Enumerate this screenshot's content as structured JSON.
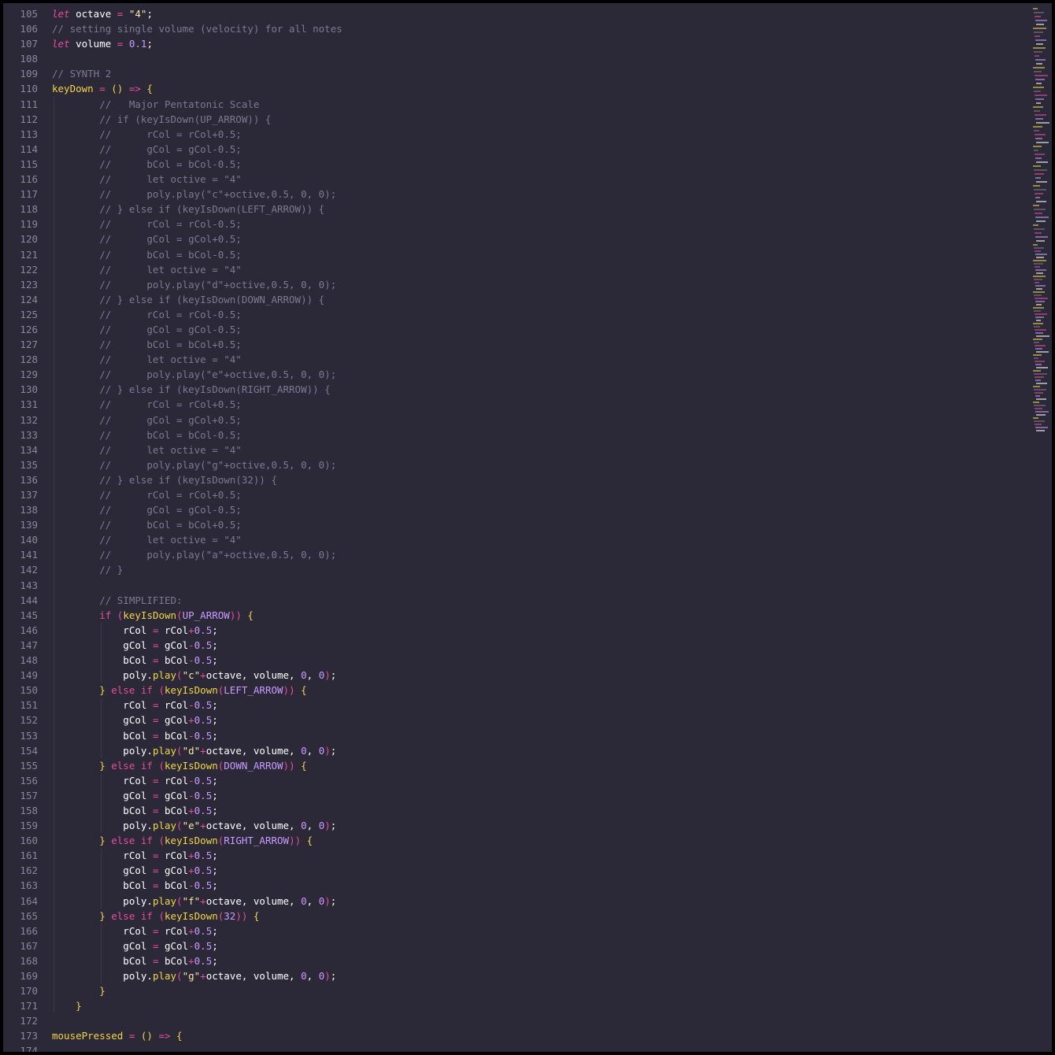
{
  "editor": {
    "first_line": 105,
    "lines": [
      [
        [
          "kw",
          "let"
        ],
        [
          "id",
          " octave "
        ],
        [
          "op",
          "="
        ],
        [
          "str",
          " \"4\""
        ],
        [
          "id",
          ";"
        ]
      ],
      [
        [
          "cmt",
          "// setting single volume (velocity) for all notes"
        ]
      ],
      [
        [
          "kw",
          "let"
        ],
        [
          "id",
          " volume "
        ],
        [
          "op",
          "="
        ],
        [
          "num",
          " 0.1"
        ],
        [
          "id",
          ";"
        ]
      ],
      [],
      [
        [
          "cmt",
          "// SYNTH 2"
        ]
      ],
      [
        [
          "fn",
          "keyDown"
        ],
        [
          "op",
          " ="
        ],
        [
          "brace",
          " ()"
        ],
        [
          "op",
          " =>"
        ],
        [
          "brace",
          " {"
        ]
      ],
      [
        [
          "cmt",
          "        //   Major Pentatonic Scale"
        ]
      ],
      [
        [
          "cmt",
          "        // if (keyIsDown(UP_ARROW)) {"
        ]
      ],
      [
        [
          "cmt",
          "        //      rCol = rCol+0.5;"
        ]
      ],
      [
        [
          "cmt",
          "        //      gCol = gCol-0.5;"
        ]
      ],
      [
        [
          "cmt",
          "        //      bCol = bCol-0.5;"
        ]
      ],
      [
        [
          "cmt",
          "        //      let octive = \"4\""
        ]
      ],
      [
        [
          "cmt",
          "        //      poly.play(\"c\"+octive,0.5, 0, 0);"
        ]
      ],
      [
        [
          "cmt",
          "        // } else if (keyIsDown(LEFT_ARROW)) {"
        ]
      ],
      [
        [
          "cmt",
          "        //      rCol = rCol-0.5;"
        ]
      ],
      [
        [
          "cmt",
          "        //      gCol = gCol+0.5;"
        ]
      ],
      [
        [
          "cmt",
          "        //      bCol = bCol-0.5;"
        ]
      ],
      [
        [
          "cmt",
          "        //      let octive = \"4\""
        ]
      ],
      [
        [
          "cmt",
          "        //      poly.play(\"d\"+octive,0.5, 0, 0);"
        ]
      ],
      [
        [
          "cmt",
          "        // } else if (keyIsDown(DOWN_ARROW)) {"
        ]
      ],
      [
        [
          "cmt",
          "        //      rCol = rCol-0.5;"
        ]
      ],
      [
        [
          "cmt",
          "        //      gCol = gCol-0.5;"
        ]
      ],
      [
        [
          "cmt",
          "        //      bCol = bCol+0.5;"
        ]
      ],
      [
        [
          "cmt",
          "        //      let octive = \"4\""
        ]
      ],
      [
        [
          "cmt",
          "        //      poly.play(\"e\"+octive,0.5, 0, 0);"
        ]
      ],
      [
        [
          "cmt",
          "        // } else if (keyIsDown(RIGHT_ARROW)) {"
        ]
      ],
      [
        [
          "cmt",
          "        //      rCol = rCol+0.5;"
        ]
      ],
      [
        [
          "cmt",
          "        //      gCol = gCol+0.5;"
        ]
      ],
      [
        [
          "cmt",
          "        //      bCol = bCol-0.5;"
        ]
      ],
      [
        [
          "cmt",
          "        //      let octive = \"4\""
        ]
      ],
      [
        [
          "cmt",
          "        //      poly.play(\"g\"+octive,0.5, 0, 0);"
        ]
      ],
      [
        [
          "cmt",
          "        // } else if (keyIsDown(32)) {"
        ]
      ],
      [
        [
          "cmt",
          "        //      rCol = rCol+0.5;"
        ]
      ],
      [
        [
          "cmt",
          "        //      gCol = gCol-0.5;"
        ]
      ],
      [
        [
          "cmt",
          "        //      bCol = bCol+0.5;"
        ]
      ],
      [
        [
          "cmt",
          "        //      let octive = \"4\""
        ]
      ],
      [
        [
          "cmt",
          "        //      poly.play(\"a\"+octive,0.5, 0, 0);"
        ]
      ],
      [
        [
          "cmt",
          "        // }"
        ]
      ],
      [],
      [
        [
          "cmt",
          "        // SIMPLIFIED:"
        ]
      ],
      [
        [
          "id",
          "        "
        ],
        [
          "kw2",
          "if"
        ],
        [
          "paren",
          " ("
        ],
        [
          "fn",
          "keyIsDown"
        ],
        [
          "paren",
          "("
        ],
        [
          "const",
          "UP_ARROW"
        ],
        [
          "paren",
          "))"
        ],
        [
          "brace",
          " {"
        ]
      ],
      [
        [
          "id",
          "            rCol "
        ],
        [
          "op",
          "="
        ],
        [
          "id",
          " rCol"
        ],
        [
          "op",
          "+"
        ],
        [
          "num",
          "0.5"
        ],
        [
          "id",
          ";"
        ]
      ],
      [
        [
          "id",
          "            gCol "
        ],
        [
          "op",
          "="
        ],
        [
          "id",
          " gCol"
        ],
        [
          "op",
          "-"
        ],
        [
          "num",
          "0.5"
        ],
        [
          "id",
          ";"
        ]
      ],
      [
        [
          "id",
          "            bCol "
        ],
        [
          "op",
          "="
        ],
        [
          "id",
          " bCol"
        ],
        [
          "op",
          "-"
        ],
        [
          "num",
          "0.5"
        ],
        [
          "id",
          ";"
        ]
      ],
      [
        [
          "id",
          "            poly."
        ],
        [
          "fn",
          "play"
        ],
        [
          "paren",
          "("
        ],
        [
          "str",
          "\"c\""
        ],
        [
          "op",
          "+"
        ],
        [
          "id",
          "octave, volume, "
        ],
        [
          "num",
          "0"
        ],
        [
          "id",
          ", "
        ],
        [
          "num",
          "0"
        ],
        [
          "paren",
          ")"
        ],
        [
          "id",
          ";"
        ]
      ],
      [
        [
          "brace",
          "        }"
        ],
        [
          "kw2",
          " else if"
        ],
        [
          "paren",
          " ("
        ],
        [
          "fn",
          "keyIsDown"
        ],
        [
          "paren",
          "("
        ],
        [
          "const",
          "LEFT_ARROW"
        ],
        [
          "paren",
          "))"
        ],
        [
          "brace",
          " {"
        ]
      ],
      [
        [
          "id",
          "            rCol "
        ],
        [
          "op",
          "="
        ],
        [
          "id",
          " rCol"
        ],
        [
          "op",
          "-"
        ],
        [
          "num",
          "0.5"
        ],
        [
          "id",
          ";"
        ]
      ],
      [
        [
          "id",
          "            gCol "
        ],
        [
          "op",
          "="
        ],
        [
          "id",
          " gCol"
        ],
        [
          "op",
          "+"
        ],
        [
          "num",
          "0.5"
        ],
        [
          "id",
          ";"
        ]
      ],
      [
        [
          "id",
          "            bCol "
        ],
        [
          "op",
          "="
        ],
        [
          "id",
          " bCol"
        ],
        [
          "op",
          "-"
        ],
        [
          "num",
          "0.5"
        ],
        [
          "id",
          ";"
        ]
      ],
      [
        [
          "id",
          "            poly."
        ],
        [
          "fn",
          "play"
        ],
        [
          "paren",
          "("
        ],
        [
          "str",
          "\"d\""
        ],
        [
          "op",
          "+"
        ],
        [
          "id",
          "octave, volume, "
        ],
        [
          "num",
          "0"
        ],
        [
          "id",
          ", "
        ],
        [
          "num",
          "0"
        ],
        [
          "paren",
          ")"
        ],
        [
          "id",
          ";"
        ]
      ],
      [
        [
          "brace",
          "        }"
        ],
        [
          "kw2",
          " else if"
        ],
        [
          "paren",
          " ("
        ],
        [
          "fn",
          "keyIsDown"
        ],
        [
          "paren",
          "("
        ],
        [
          "const",
          "DOWN_ARROW"
        ],
        [
          "paren",
          "))"
        ],
        [
          "brace",
          " {"
        ]
      ],
      [
        [
          "id",
          "            rCol "
        ],
        [
          "op",
          "="
        ],
        [
          "id",
          " rCol"
        ],
        [
          "op",
          "-"
        ],
        [
          "num",
          "0.5"
        ],
        [
          "id",
          ";"
        ]
      ],
      [
        [
          "id",
          "            gCol "
        ],
        [
          "op",
          "="
        ],
        [
          "id",
          " gCol"
        ],
        [
          "op",
          "-"
        ],
        [
          "num",
          "0.5"
        ],
        [
          "id",
          ";"
        ]
      ],
      [
        [
          "id",
          "            bCol "
        ],
        [
          "op",
          "="
        ],
        [
          "id",
          " bCol"
        ],
        [
          "op",
          "+"
        ],
        [
          "num",
          "0.5"
        ],
        [
          "id",
          ";"
        ]
      ],
      [
        [
          "id",
          "            poly."
        ],
        [
          "fn",
          "play"
        ],
        [
          "paren",
          "("
        ],
        [
          "str",
          "\"e\""
        ],
        [
          "op",
          "+"
        ],
        [
          "id",
          "octave, volume, "
        ],
        [
          "num",
          "0"
        ],
        [
          "id",
          ", "
        ],
        [
          "num",
          "0"
        ],
        [
          "paren",
          ")"
        ],
        [
          "id",
          ";"
        ]
      ],
      [
        [
          "brace",
          "        }"
        ],
        [
          "kw2",
          " else if"
        ],
        [
          "paren",
          " ("
        ],
        [
          "fn",
          "keyIsDown"
        ],
        [
          "paren",
          "("
        ],
        [
          "const",
          "RIGHT_ARROW"
        ],
        [
          "paren",
          "))"
        ],
        [
          "brace",
          " {"
        ]
      ],
      [
        [
          "id",
          "            rCol "
        ],
        [
          "op",
          "="
        ],
        [
          "id",
          " rCol"
        ],
        [
          "op",
          "+"
        ],
        [
          "num",
          "0.5"
        ],
        [
          "id",
          ";"
        ]
      ],
      [
        [
          "id",
          "            gCol "
        ],
        [
          "op",
          "="
        ],
        [
          "id",
          " gCol"
        ],
        [
          "op",
          "+"
        ],
        [
          "num",
          "0.5"
        ],
        [
          "id",
          ";"
        ]
      ],
      [
        [
          "id",
          "            bCol "
        ],
        [
          "op",
          "="
        ],
        [
          "id",
          " bCol"
        ],
        [
          "op",
          "-"
        ],
        [
          "num",
          "0.5"
        ],
        [
          "id",
          ";"
        ]
      ],
      [
        [
          "id",
          "            poly."
        ],
        [
          "fn",
          "play"
        ],
        [
          "paren",
          "("
        ],
        [
          "str",
          "\"f\""
        ],
        [
          "op",
          "+"
        ],
        [
          "id",
          "octave, volume, "
        ],
        [
          "num",
          "0"
        ],
        [
          "id",
          ", "
        ],
        [
          "num",
          "0"
        ],
        [
          "paren",
          ")"
        ],
        [
          "id",
          ";"
        ]
      ],
      [
        [
          "brace",
          "        }"
        ],
        [
          "kw2",
          " else if"
        ],
        [
          "paren",
          " ("
        ],
        [
          "fn",
          "keyIsDown"
        ],
        [
          "paren",
          "("
        ],
        [
          "num",
          "32"
        ],
        [
          "paren",
          "))"
        ],
        [
          "brace",
          " {"
        ]
      ],
      [
        [
          "id",
          "            rCol "
        ],
        [
          "op",
          "="
        ],
        [
          "id",
          " rCol"
        ],
        [
          "op",
          "+"
        ],
        [
          "num",
          "0.5"
        ],
        [
          "id",
          ";"
        ]
      ],
      [
        [
          "id",
          "            gCol "
        ],
        [
          "op",
          "="
        ],
        [
          "id",
          " gCol"
        ],
        [
          "op",
          "-"
        ],
        [
          "num",
          "0.5"
        ],
        [
          "id",
          ";"
        ]
      ],
      [
        [
          "id",
          "            bCol "
        ],
        [
          "op",
          "="
        ],
        [
          "id",
          " bCol"
        ],
        [
          "op",
          "+"
        ],
        [
          "num",
          "0.5"
        ],
        [
          "id",
          ";"
        ]
      ],
      [
        [
          "id",
          "            poly."
        ],
        [
          "fn",
          "play"
        ],
        [
          "paren",
          "("
        ],
        [
          "str",
          "\"g\""
        ],
        [
          "op",
          "+"
        ],
        [
          "id",
          "octave, volume, "
        ],
        [
          "num",
          "0"
        ],
        [
          "id",
          ", "
        ],
        [
          "num",
          "0"
        ],
        [
          "paren",
          ")"
        ],
        [
          "id",
          ";"
        ]
      ],
      [
        [
          "brace",
          "        }"
        ]
      ],
      [
        [
          "brace",
          "    }"
        ]
      ],
      [],
      [
        [
          "fn",
          "mousePressed"
        ],
        [
          "op",
          " ="
        ],
        [
          "brace",
          " ()"
        ],
        [
          "op",
          " =>"
        ],
        [
          "brace",
          " {"
        ]
      ],
      []
    ]
  },
  "colors": {
    "background": "#2b2838",
    "line_number": "#8a8799",
    "comment": "#7d7a8d",
    "keyword": "#e84e9c",
    "function": "#f5d547",
    "string": "#f6e8a8",
    "number": "#c99cff"
  }
}
